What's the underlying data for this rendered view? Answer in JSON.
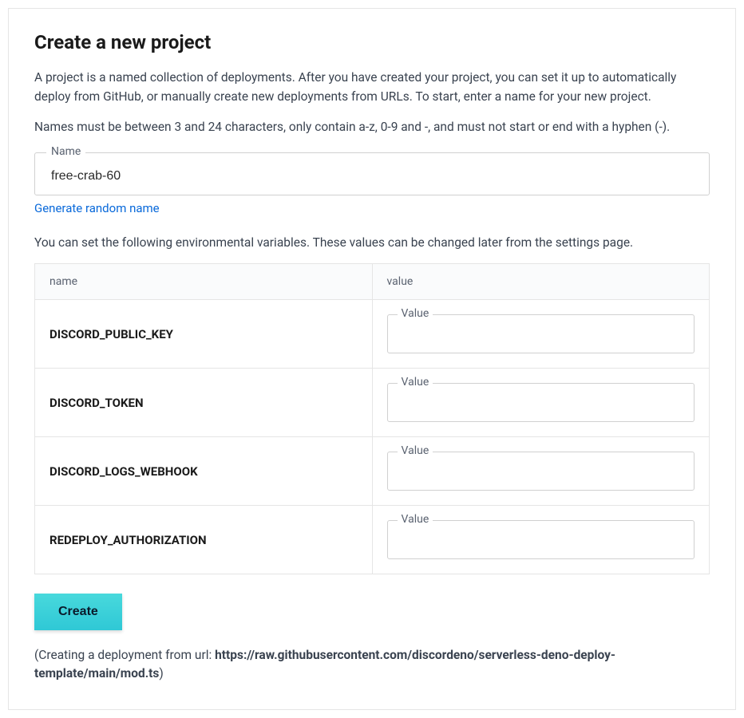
{
  "header": {
    "title": "Create a new project"
  },
  "description": {
    "para1": "A project is a named collection of deployments. After you have created your project, you can set it up to automatically deploy from GitHub, or manually create new deployments from URLs. To start, enter a name for your new project.",
    "para2": "Names must be between 3 and 24 characters, only contain a-z, 0-9 and -, and must not start or end with a hyphen (-)."
  },
  "name_field": {
    "label": "Name",
    "value": "free-crab-60"
  },
  "generate_link": "Generate random name",
  "env_section": {
    "intro": "You can set the following environmental variables. These values can be changed later from the settings page.",
    "columns": {
      "name": "name",
      "value": "value"
    },
    "value_label": "Value",
    "vars": [
      {
        "name": "DISCORD_PUBLIC_KEY",
        "value": ""
      },
      {
        "name": "DISCORD_TOKEN",
        "value": ""
      },
      {
        "name": "DISCORD_LOGS_WEBHOOK",
        "value": ""
      },
      {
        "name": "REDEPLOY_AUTHORIZATION",
        "value": ""
      }
    ]
  },
  "create_button": "Create",
  "footer": {
    "prefix": "(Creating a deployment from url: ",
    "url": "https://raw.githubusercontent.com/discordeno/serverless-deno-deploy-template/main/mod.ts",
    "suffix": ")"
  }
}
